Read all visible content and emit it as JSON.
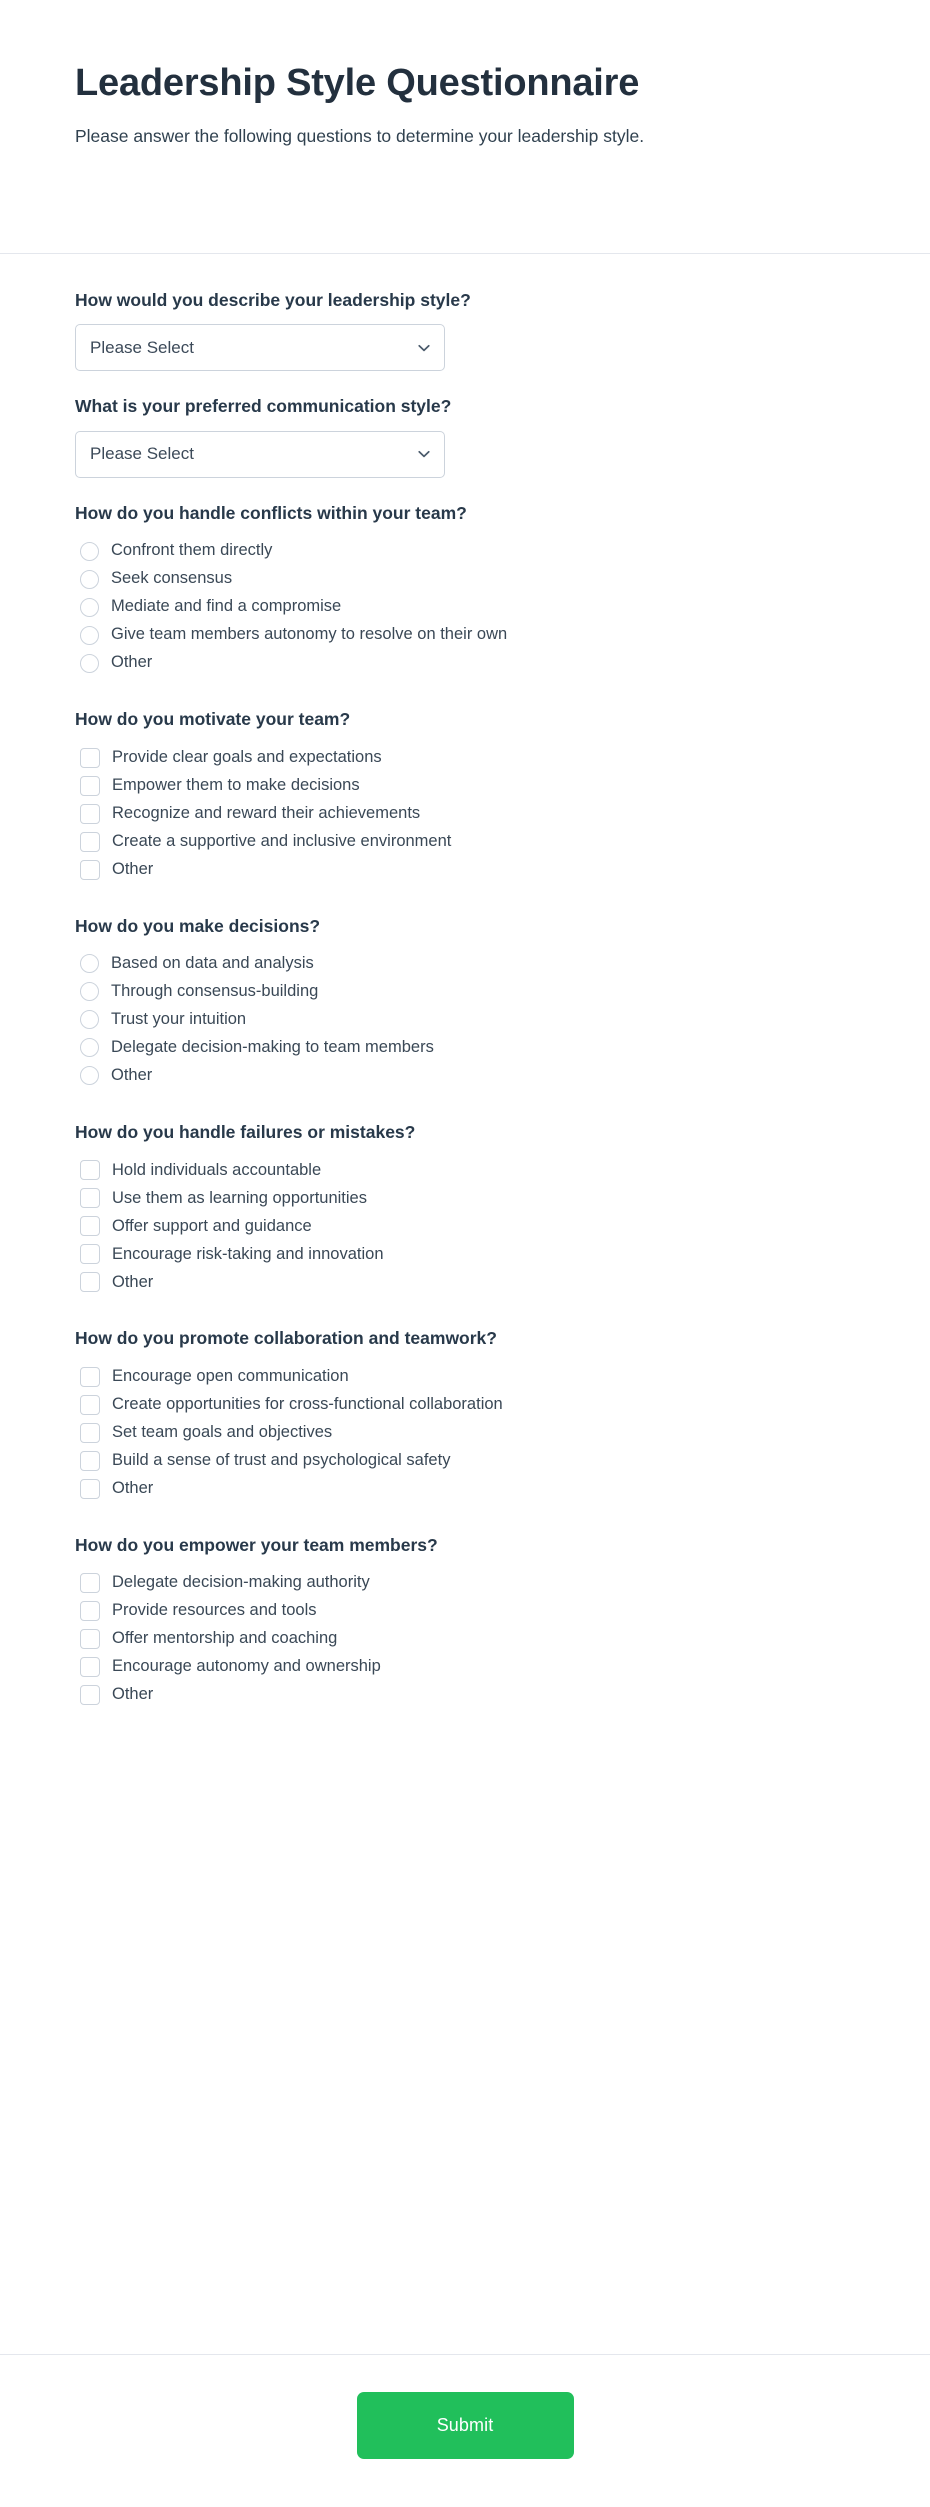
{
  "header": {
    "title": "Leadership Style Questionnaire",
    "subtitle": "Please answer the following questions to determine your leadership style."
  },
  "select_placeholder": "Please Select",
  "chevron_icon_name": "chevron-down-icon",
  "colors": {
    "submit_green": "#21bf5b",
    "border": "#ccd3dc",
    "divider": "#e4e7ed",
    "title": "#23303e",
    "text": "#3a4856"
  },
  "questions": [
    {
      "label": "How would you describe your leadership style?",
      "type": "select",
      "value": "Please Select"
    },
    {
      "label": "What is your preferred communication style?",
      "type": "select",
      "value": "Please Select"
    },
    {
      "label": "How do you handle conflicts within your team?",
      "type": "radio",
      "options": [
        "Confront them directly",
        "Seek consensus",
        "Mediate and find a compromise",
        "Give team members autonomy to resolve on their own",
        "Other"
      ]
    },
    {
      "label": "How do you motivate your team?",
      "type": "checkbox",
      "options": [
        "Provide clear goals and expectations",
        "Empower them to make decisions",
        "Recognize and reward their achievements",
        "Create a supportive and inclusive environment",
        "Other"
      ]
    },
    {
      "label": "How do you make decisions?",
      "type": "radio",
      "options": [
        "Based on data and analysis",
        "Through consensus-building",
        "Trust your intuition",
        "Delegate decision-making to team members",
        "Other"
      ]
    },
    {
      "label": "How do you handle failures or mistakes?",
      "type": "checkbox",
      "options": [
        "Hold individuals accountable",
        "Use them as learning opportunities",
        "Offer support and guidance",
        "Encourage risk-taking and innovation",
        "Other"
      ]
    },
    {
      "label": "How do you promote collaboration and teamwork?",
      "type": "checkbox",
      "options": [
        "Encourage open communication",
        "Create opportunities for cross-functional collaboration",
        "Set team goals and objectives",
        "Build a sense of trust and psychological safety",
        "Other"
      ]
    },
    {
      "label": "How do you empower your team members?",
      "type": "checkbox",
      "options": [
        "Delegate decision-making authority",
        "Provide resources and tools",
        "Offer mentorship and coaching",
        "Encourage autonomy and ownership",
        "Other"
      ]
    }
  ],
  "footer": {
    "submit_label": "Submit"
  }
}
